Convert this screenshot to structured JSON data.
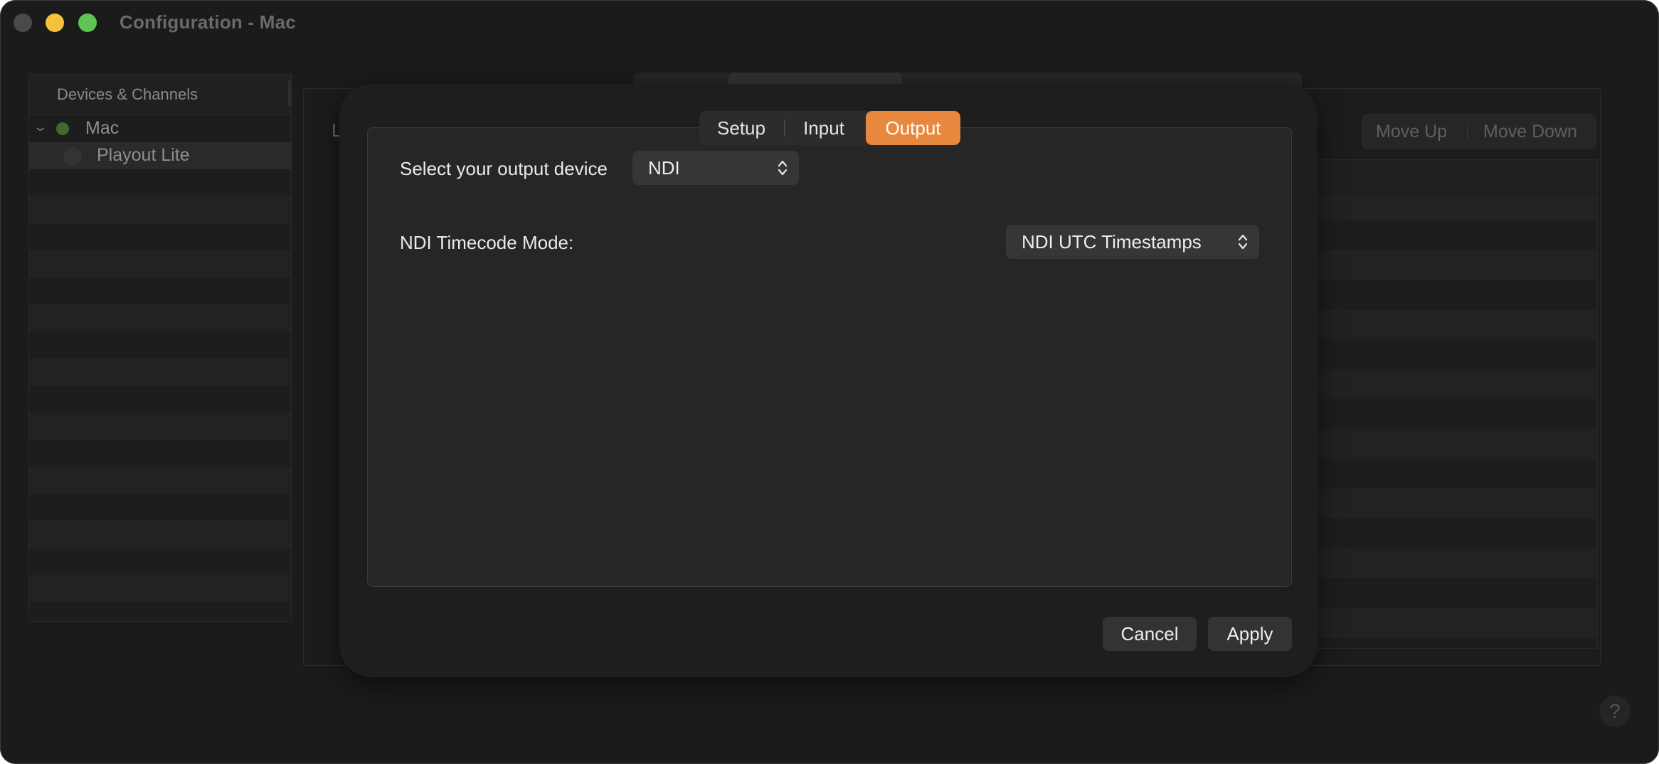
{
  "window": {
    "title": "Configuration - Mac"
  },
  "sidebar": {
    "header": "Devices & Channels",
    "items": [
      {
        "label": "Mac",
        "status_color": "#3f6a2e",
        "expanded": true
      },
      {
        "label": "Playout Lite"
      }
    ]
  },
  "background": {
    "partial_letter": "L",
    "move_up_label": "Move Up",
    "move_down_label": "Move Down",
    "help_label": "?"
  },
  "dialog": {
    "tabs": [
      {
        "label": "Setup",
        "selected": false
      },
      {
        "label": "Input",
        "selected": false
      },
      {
        "label": "Output",
        "selected": true
      }
    ],
    "accent_color": "#e8883e",
    "output_device": {
      "label": "Select your output device",
      "value": "NDI"
    },
    "timecode_mode": {
      "label": "NDI Timecode Mode:",
      "value": "NDI UTC Timestamps"
    },
    "cancel_label": "Cancel",
    "apply_label": "Apply"
  }
}
